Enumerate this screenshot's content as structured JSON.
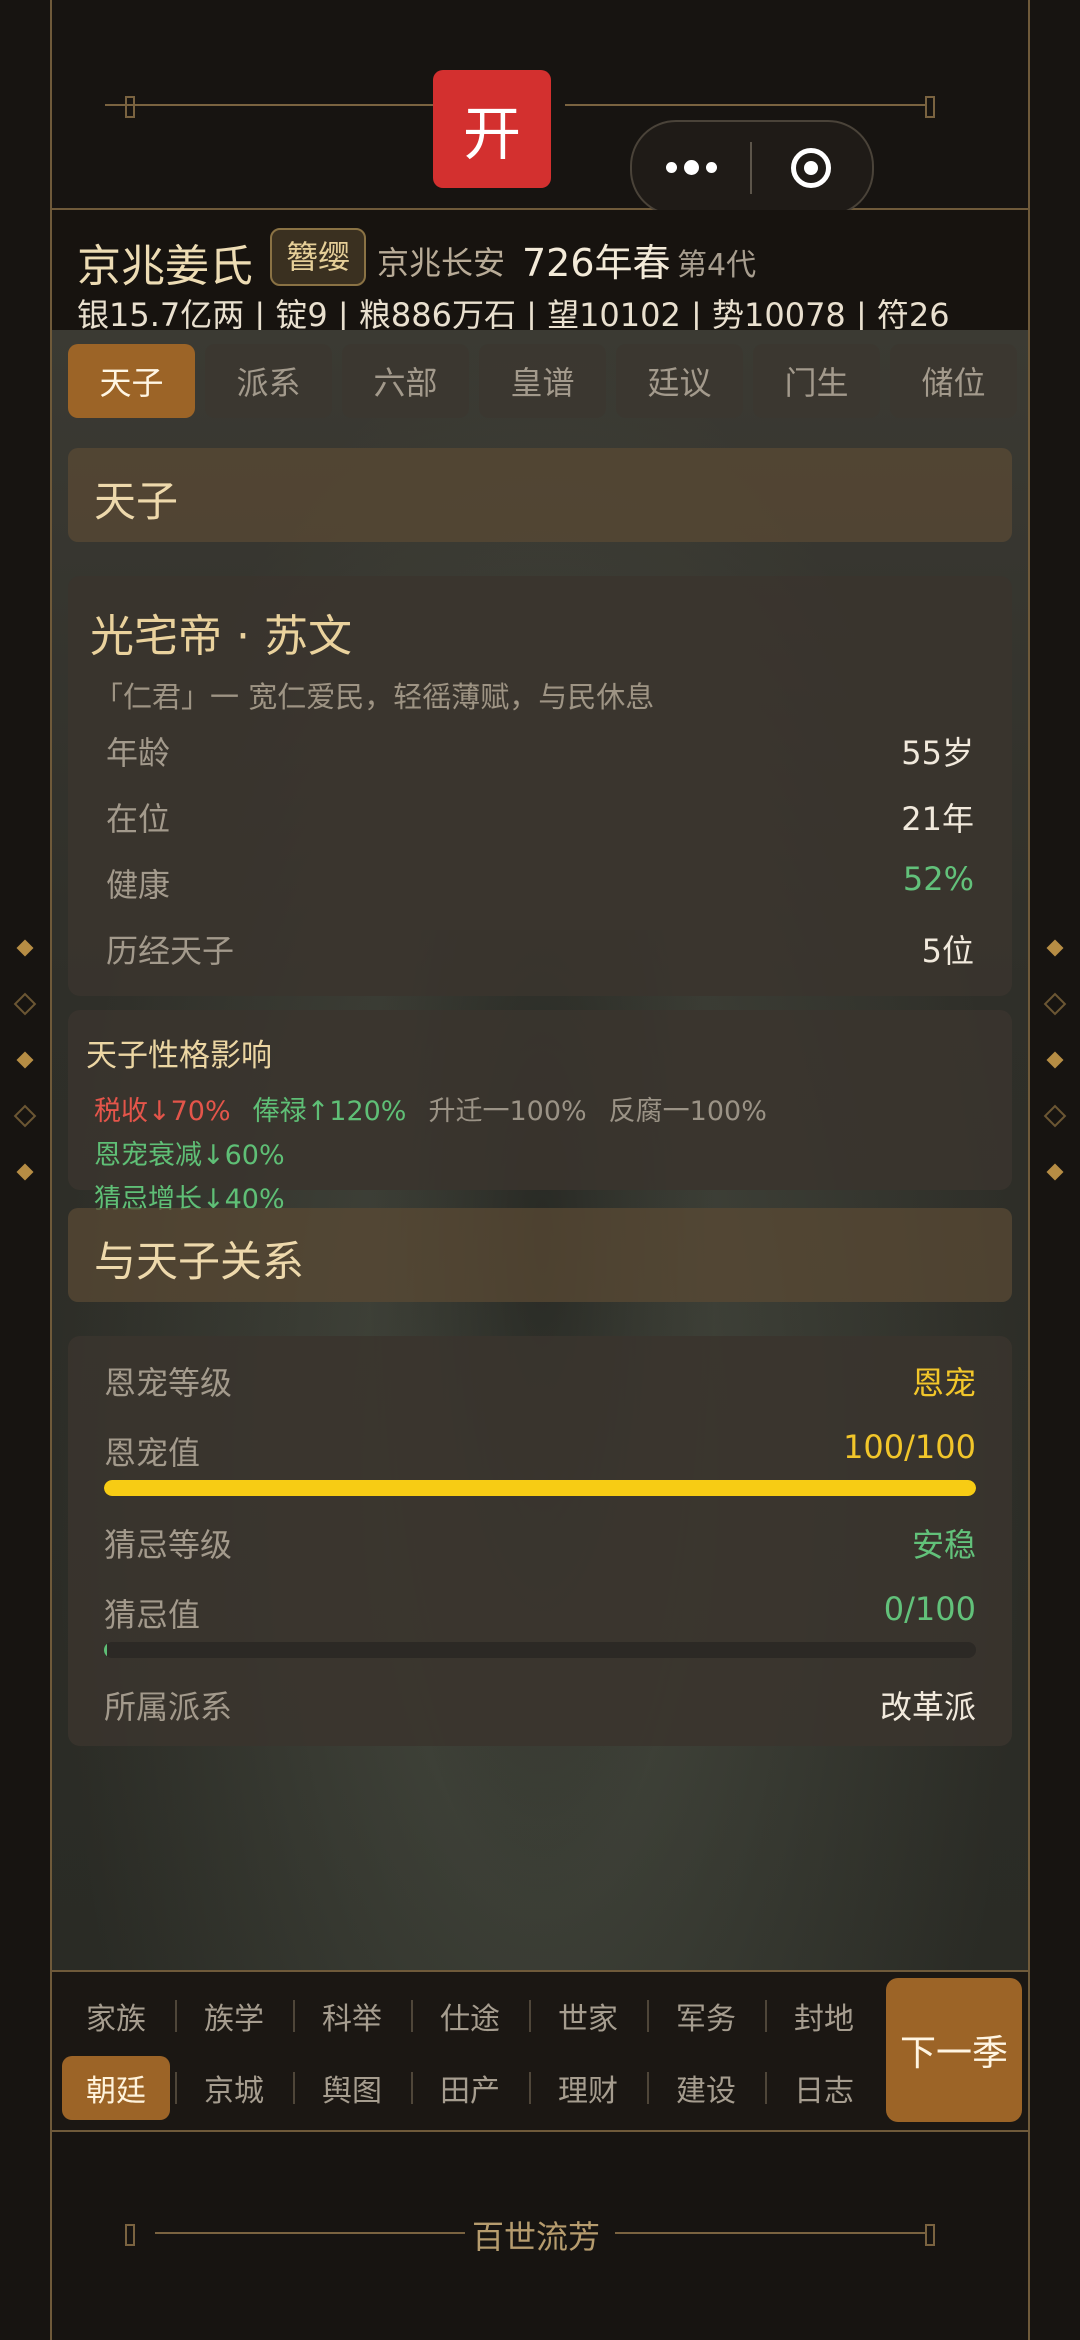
{
  "app_title": "百世流芳",
  "title_visible_fragment": "流芳",
  "open_badge": "开",
  "header": {
    "clan_name": "京兆姜氏",
    "rank_badge": "簪缨",
    "location": "京兆长安",
    "year_season": "726年春",
    "generation": "第4代",
    "resources": "银15.7亿两 | 锭9 | 粮886万石 | 望10102 | 势10078 | 符26"
  },
  "tabs": [
    "天子",
    "派系",
    "六部",
    "皇谱",
    "廷议",
    "门生",
    "储位"
  ],
  "active_tab_index": 0,
  "section_emperor": "天子",
  "emperor": {
    "name": "光宅帝 · 苏文",
    "description": "「仁君」一 宽仁爱民，轻徭薄赋，与民休息",
    "stats": [
      {
        "label": "年龄",
        "value": "55岁"
      },
      {
        "label": "在位",
        "value": "21年"
      },
      {
        "label": "健康",
        "value": "52%"
      },
      {
        "label": "历经天子",
        "value": "5位"
      }
    ]
  },
  "traits": {
    "title": "天子性格影响",
    "items": [
      {
        "text": "税收↓70%",
        "tone": "red"
      },
      {
        "text": "俸禄↑120%",
        "tone": "green"
      },
      {
        "text": "升迁一100%",
        "tone": "gray"
      },
      {
        "text": "反腐一100%",
        "tone": "gray"
      },
      {
        "text": "恩宠衰减↓60%",
        "tone": "green"
      },
      {
        "text": "猜忌增长↓40%",
        "tone": "green"
      }
    ]
  },
  "section_relation": "与天子关系",
  "relation": {
    "favor_level_label": "恩宠等级",
    "favor_level_value": "恩宠",
    "favor_value_label": "恩宠值",
    "favor_value": "100/100",
    "favor_fraction": 1.0,
    "suspicion_level_label": "猜忌等级",
    "suspicion_level_value": "安稳",
    "suspicion_value_label": "猜忌值",
    "suspicion_value": "0/100",
    "suspicion_fraction": 0.0,
    "faction_label": "所属派系",
    "faction_value": "改革派"
  },
  "nav": {
    "row1": [
      "家族",
      "族学",
      "科举",
      "仕途",
      "世家",
      "军务",
      "封地"
    ],
    "row2": [
      "朝廷",
      "京城",
      "舆图",
      "田产",
      "理财",
      "建设",
      "日志"
    ],
    "active": "朝廷",
    "next_button": "下一季"
  },
  "colors": {
    "accent": "#9c6427",
    "gold": "#f7cc14",
    "green": "#5fbf76",
    "red": "#e4554a",
    "badge_red": "#d3302f"
  }
}
